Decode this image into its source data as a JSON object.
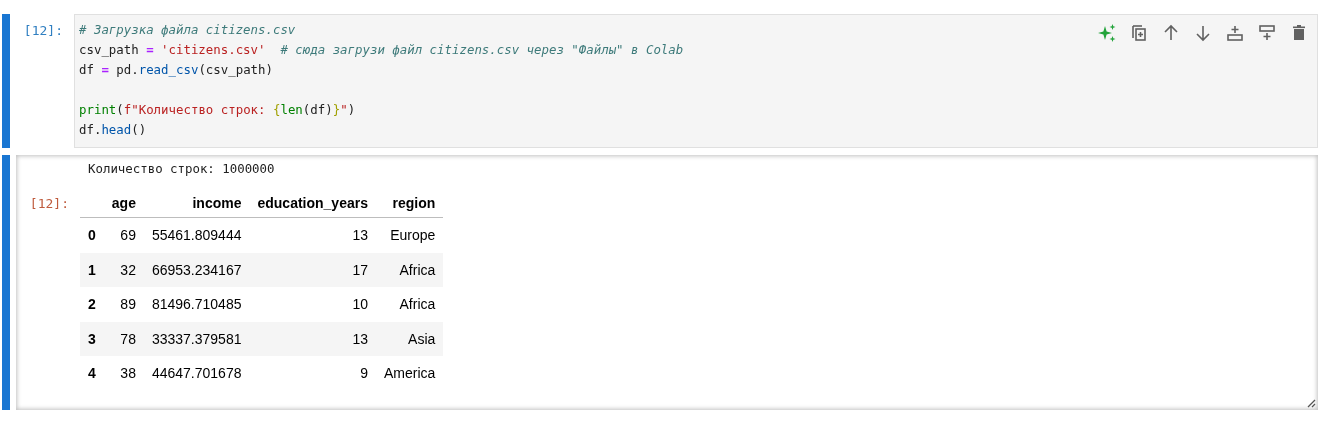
{
  "input_cell": {
    "prompt": "[12]:",
    "selected": true,
    "blocks": [
      [
        [
          {
            "kind": "comment",
            "text": "# Загрузка файла citizens.csv"
          }
        ],
        [
          {
            "kind": "name",
            "text": "csv_path "
          },
          {
            "kind": "op",
            "text": "= "
          },
          {
            "kind": "string",
            "text": "'citizens.csv'  "
          },
          {
            "kind": "comment",
            "text": "# сюда загрузи файл citizens.csv через \"Файлы\" в Colab"
          }
        ],
        [
          {
            "kind": "name",
            "text": "df "
          },
          {
            "kind": "op",
            "text": "= "
          },
          {
            "kind": "name",
            "text": "pd."
          },
          {
            "kind": "attr",
            "text": "read_csv"
          },
          {
            "kind": "name",
            "text": "(csv_path)"
          }
        ]
      ],
      [
        [
          {
            "kind": "builtin",
            "text": "print"
          },
          {
            "kind": "name",
            "text": "("
          },
          {
            "kind": "string",
            "text": "f\"Количество строк: "
          },
          {
            "kind": "interp",
            "text": "{"
          },
          {
            "kind": "builtin",
            "text": "len"
          },
          {
            "kind": "name",
            "text": "(df)"
          },
          {
            "kind": "interp",
            "text": "}"
          },
          {
            "kind": "string",
            "text": "\""
          },
          {
            "kind": "name",
            "text": ")"
          }
        ],
        [
          {
            "kind": "name",
            "text": "df."
          },
          {
            "kind": "attr",
            "text": "head"
          },
          {
            "kind": "name",
            "text": "()"
          }
        ]
      ]
    ],
    "toolbar": [
      {
        "kind": "sparkle"
      },
      {
        "kind": "copy"
      },
      {
        "kind": "up"
      },
      {
        "kind": "down"
      },
      {
        "kind": "insert-above"
      },
      {
        "kind": "insert-below"
      },
      {
        "kind": "delete"
      }
    ]
  },
  "output_cell": {
    "prompt": "[12]:",
    "selected": true,
    "stdout": "Количество строк: 1000000",
    "table": {
      "columns": [
        "",
        "age",
        "income",
        "education_years",
        "region"
      ],
      "rows": [
        [
          "0",
          "69",
          "55461.809444",
          "13",
          "Europe"
        ],
        [
          "1",
          "32",
          "66953.234167",
          "17",
          "Africa"
        ],
        [
          "2",
          "89",
          "81496.710485",
          "10",
          "Africa"
        ],
        [
          "3",
          "78",
          "33337.379581",
          "13",
          "Asia"
        ],
        [
          "4",
          "38",
          "44647.701678",
          "9",
          "America"
        ]
      ]
    }
  }
}
